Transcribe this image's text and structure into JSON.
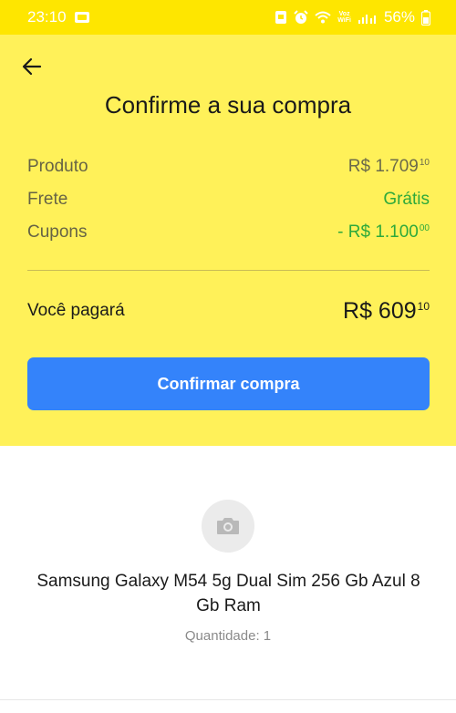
{
  "status_bar": {
    "time": "23:10",
    "voz_line1": "Voz",
    "voz_line2": "WiFi",
    "battery": "56%"
  },
  "header": {
    "back_icon": "arrow-left-icon",
    "title": "Confirme a sua compra"
  },
  "summary": {
    "rows": [
      {
        "label": "Produto",
        "amount": "R$ 1.709",
        "cents": "10",
        "color": "#6b6a4a"
      },
      {
        "label": "Frete",
        "amount": "Grátis",
        "cents": "",
        "color": "#2ea93b"
      },
      {
        "label": "Cupons",
        "amount": "- R$ 1.100",
        "cents": "00",
        "color": "#2ea93b"
      }
    ],
    "total_label": "Você pagará",
    "total_amount": "R$ 609",
    "total_cents": "10"
  },
  "confirm_button": "Confirmar compra",
  "product": {
    "image_icon": "camera-icon",
    "name": "Samsung Galaxy M54 5g Dual Sim 256 Gb Azul 8 Gb Ram",
    "quantity": "Quantidade: 1"
  },
  "colors": {
    "header_bg": "#fff159",
    "status_bg": "#fee600",
    "primary_button": "#3483fa",
    "green": "#2ea93b"
  }
}
